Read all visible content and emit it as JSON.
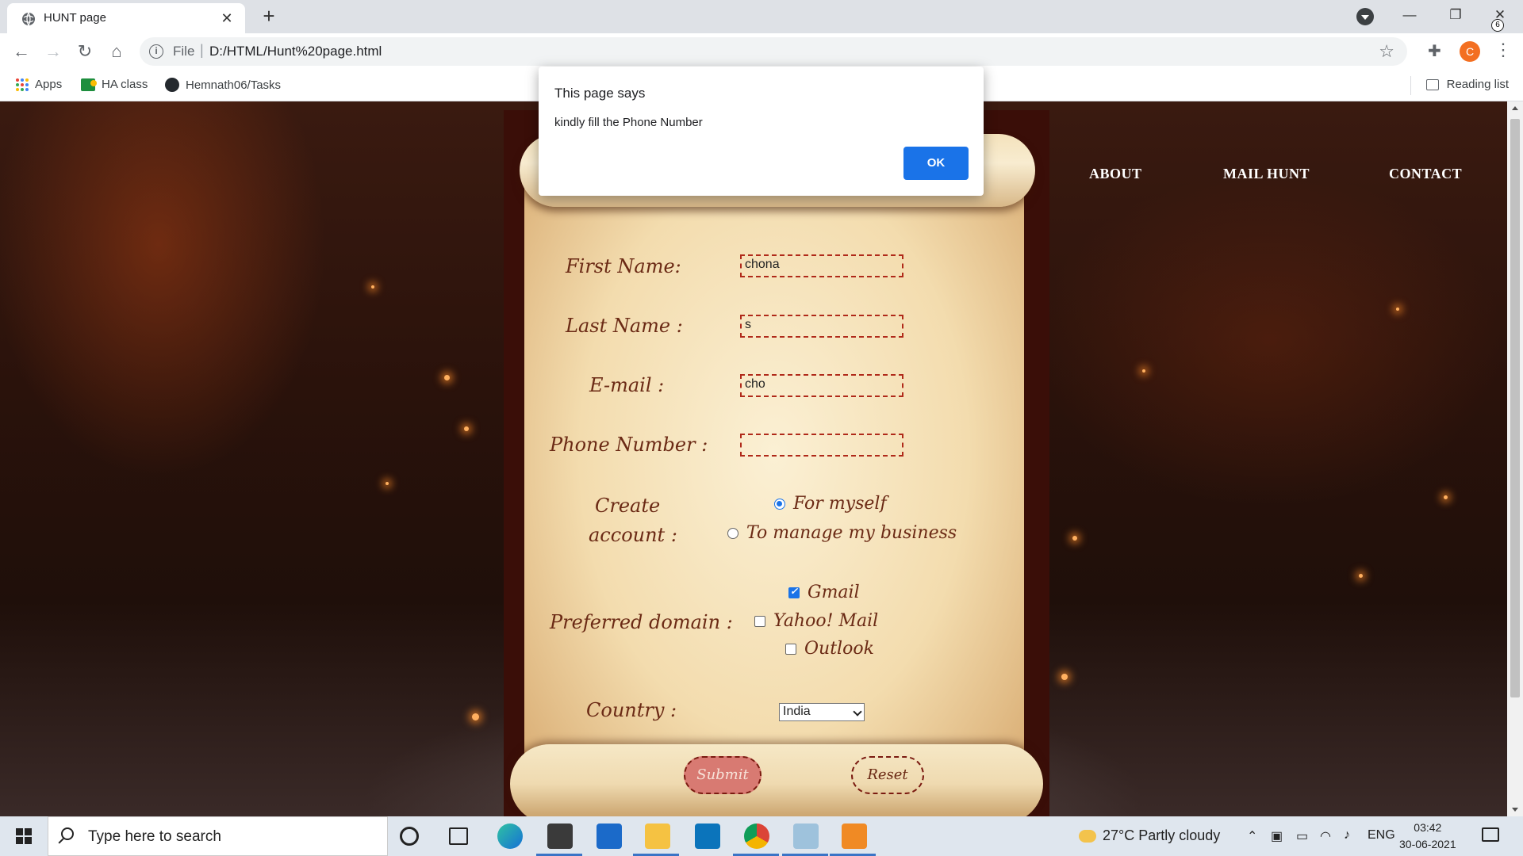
{
  "browser": {
    "tab_title": "HUNT page",
    "url_scheme": "File",
    "url": "D:/HTML/Hunt%20page.html",
    "avatar_letter": "C",
    "bookmarks": [
      "Apps",
      "HA class",
      "Hemnath06/Tasks"
    ],
    "reading_list": "Reading list"
  },
  "page": {
    "nav": [
      "ABOUT",
      "MAIL HUNT",
      "CONTACT"
    ],
    "form": {
      "first_name_label": "First Name:",
      "first_name_value": "chona",
      "last_name_label": "Last Name :",
      "last_name_value": "s",
      "email_label": "E-mail :",
      "email_value": "cho",
      "phone_label": "Phone Number :",
      "phone_value": "",
      "create_label_1": "Create",
      "create_label_2": "account :",
      "account_options": [
        "For myself",
        "To manage my business"
      ],
      "account_selected": "For myself",
      "domain_label": "Preferred domain :",
      "domain_options": [
        "Gmail",
        "Yahoo! Mail",
        "Outlook"
      ],
      "domain_checked": [
        "Gmail"
      ],
      "country_label": "Country :",
      "country_value": "India",
      "submit_label": "Submit",
      "reset_label": "Reset"
    }
  },
  "dialog": {
    "title": "This page says",
    "message": "kindly fill the Phone Number",
    "ok_label": "OK"
  },
  "taskbar": {
    "search_placeholder": "Type here to search",
    "weather": "27°C  Partly cloudy",
    "language": "ENG",
    "time": "03:42",
    "date": "30-06-2021",
    "notification_count": "6"
  },
  "colors": {
    "accent": "#1a73e8",
    "field_border": "#b02a1a",
    "label_text": "#6b2a15"
  }
}
